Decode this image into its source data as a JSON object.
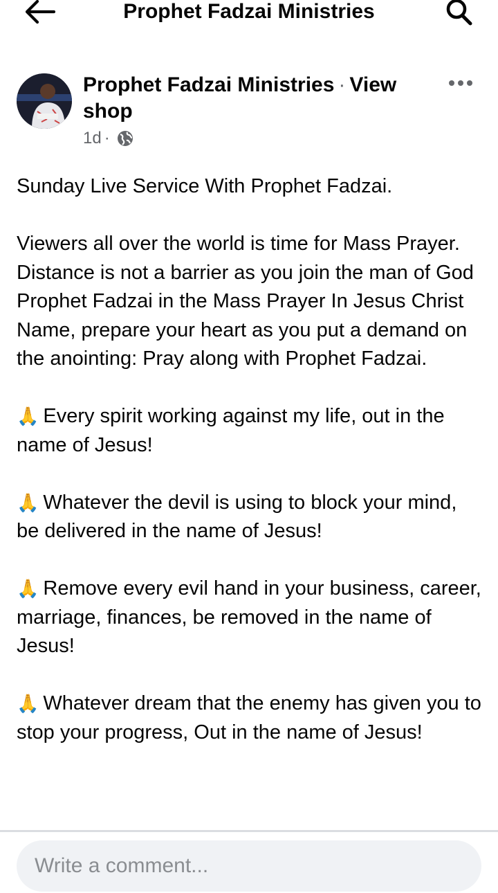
{
  "header": {
    "title": "Prophet Fadzai Ministries",
    "back_icon": "arrow-left-icon",
    "search_icon": "search-icon"
  },
  "post": {
    "author": "Prophet Fadzai Ministries",
    "separator": "·",
    "view_shop": "View shop",
    "time": "1d",
    "time_separator": "·",
    "audience_icon": "globe-icon",
    "more_icon": "more-horizontal-icon",
    "paragraphs": [
      "Sunday Live Service With Prophet Fadzai.",
      "Viewers all over the world is time for Mass Prayer. Distance is not a barrier as you join the man of God Prophet Fadzai in the Mass Prayer In Jesus Christ Name, prepare your heart as you put a demand on the anointing: Pray along with Prophet Fadzai."
    ],
    "prayers": [
      {
        "emoji": "🙏",
        "text": "Every spirit working against my life, out in the name of Jesus!"
      },
      {
        "emoji": "🙏",
        "text": "Whatever the devil is using to block your mind, be delivered in the name of Jesus!"
      },
      {
        "emoji": "🙏",
        "text": "Remove every evil hand in your business, career, marriage, finances, be removed in the name of Jesus!"
      },
      {
        "emoji": "🙏",
        "text": "Whatever dream that the enemy has given you to stop your progress, Out in the name of Jesus!"
      }
    ]
  },
  "comment": {
    "placeholder": "Write a comment..."
  }
}
